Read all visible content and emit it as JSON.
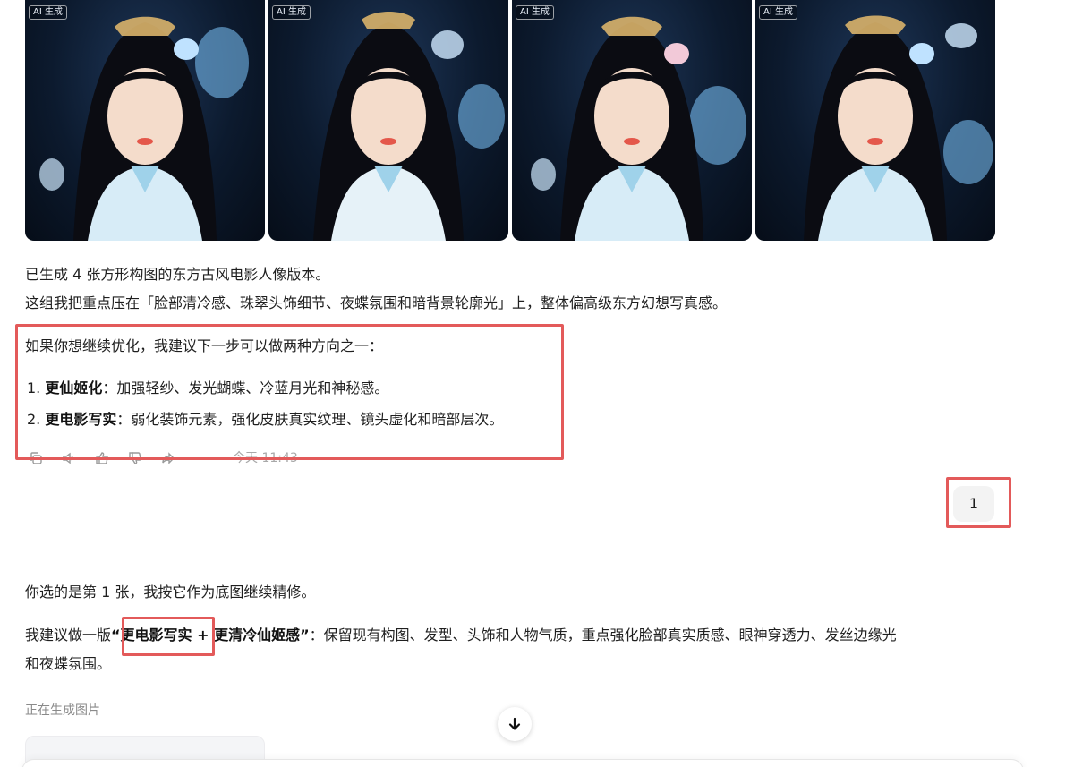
{
  "gallery": {
    "badge": "AI 生成",
    "images": [
      {
        "alt": "portrait-1"
      },
      {
        "alt": "portrait-2"
      },
      {
        "alt": "portrait-3"
      },
      {
        "alt": "portrait-4"
      }
    ]
  },
  "reply1": {
    "line1": "已生成 4 张方形构图的东方古风电影人像版本。",
    "line2": "这组我把重点压在「脸部清冷感、珠翠头饰细节、夜蝶氛围和暗背景轮廓光」上，整体偏高级东方幻想写真感。",
    "line3": "如果你想继续优化，我建议下一步可以做两种方向之一：",
    "list": [
      {
        "num": "1.",
        "title": "更仙姬化",
        "desc": "：加强轻纱、发光蝴蝶、冷蓝月光和神秘感。"
      },
      {
        "num": "2.",
        "title": "更电影写实",
        "desc": "：弱化装饰元素，强化皮肤真实纹理、镜头虚化和暗部层次。"
      }
    ],
    "timestamp": "今天 11:43"
  },
  "user_message": "1",
  "reply2": {
    "line1": "你选的是第 1 张，我按它作为底图继续精修。",
    "line2_prefix": "我建议做一版",
    "line2_q1": "“",
    "line2_bold1": "更电影写实",
    "line2_plus": " + ",
    "line2_bold2": "更清冷仙姬感",
    "line2_q2": "”",
    "line2_rest": "：保留现有构图、发型、头饰和人物气质，重点强化脸部真实质感、眼神穿透力、发丝边缘光",
    "line3": "和夜蝶氛围。",
    "status": "正在生成图片"
  },
  "colors": {
    "highlight_box": "#e35a5a",
    "bubble_bg": "#f3f3f3",
    "muted": "#a8a8a8"
  },
  "icons": [
    "copy-icon",
    "speaker-icon",
    "thumbs-up-icon",
    "thumbs-down-icon",
    "share-icon",
    "arrow-down-icon"
  ]
}
